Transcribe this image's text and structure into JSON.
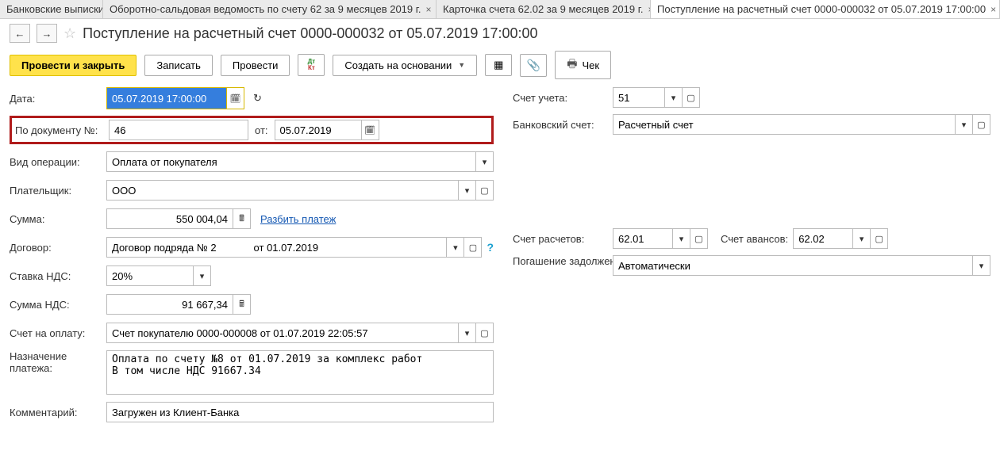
{
  "tabs": [
    {
      "label": "Банковские выписки"
    },
    {
      "label": "Оборотно-сальдовая ведомость по счету 62 за 9 месяцев 2019 г."
    },
    {
      "label": "Карточка счета 62.02 за 9 месяцев 2019 г."
    },
    {
      "label": "Поступление на расчетный счет 0000-000032 от 05.07.2019 17:00:00"
    }
  ],
  "title": "Поступление на расчетный счет 0000-000032 от 05.07.2019 17:00:00",
  "toolbar": {
    "post_close": "Провести и закрыть",
    "save": "Записать",
    "post": "Провести",
    "create_based": "Создать на основании",
    "cheque": "Чек"
  },
  "labels": {
    "date": "Дата:",
    "doc_no": "По документу №:",
    "from": "от:",
    "op_type": "Вид операции:",
    "payer": "Плательщик:",
    "sum": "Сумма:",
    "split": "Разбить платеж",
    "contract": "Договор:",
    "vat_rate": "Ставка НДС:",
    "vat_sum": "Сумма НДС:",
    "invoice": "Счет на оплату:",
    "purpose": "Назначение платежа:",
    "comment": "Комментарий:",
    "account": "Счет учета:",
    "bank_acc": "Банковский счет:",
    "settlement_acc": "Счет расчетов:",
    "advance_acc": "Счет авансов:",
    "debt_repay": "Погашение задолженности:"
  },
  "values": {
    "date": "05.07.2019 17:00:00",
    "doc_no": "46",
    "doc_date": "05.07.2019",
    "op_type": "Оплата от покупателя",
    "payer": "ООО",
    "sum": "550 004,04",
    "contract": "Договор подряда № 2             от 01.07.2019",
    "vat_rate": "20%",
    "vat_sum": "91 667,34",
    "invoice": "Счет покупателю 0000-000008 от 01.07.2019 22:05:57",
    "purpose": "Оплата по счету №8 от 01.07.2019 за комплекс работ\nВ том числе НДС 91667.34",
    "comment": "Загружен из Клиент-Банка",
    "account": "51",
    "bank_acc": "Расчетный счет",
    "settlement_acc": "62.01",
    "advance_acc": "62.02",
    "debt_repay": "Автоматически"
  }
}
